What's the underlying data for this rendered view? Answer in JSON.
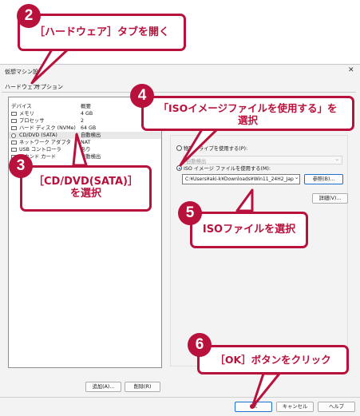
{
  "window": {
    "title": "仮想マシン設定",
    "close_glyph": "✕"
  },
  "tabs": [
    {
      "label": "ハードウェア"
    },
    {
      "label": "オプション"
    }
  ],
  "device_list": {
    "col_device": "デバイス",
    "col_summary": "概要",
    "rows": [
      {
        "device": "メモリ",
        "summary": "4 GB"
      },
      {
        "device": "プロセッサ",
        "summary": "2"
      },
      {
        "device": "ハード ディスク (NVMe)",
        "summary": "64 GB"
      },
      {
        "device": "CD/DVD (SATA)",
        "summary": "自動検出"
      },
      {
        "device": "ネットワーク アダプタ",
        "summary": "NAT"
      },
      {
        "device": "USB コントローラ",
        "summary": "あり"
      },
      {
        "device": "サウンド カード",
        "summary": "自動検出"
      }
    ]
  },
  "device_buttons": {
    "add": "追加(A)...",
    "remove": "削除(R)"
  },
  "connection": {
    "physical_label": "物理ドライブを使用する(P):",
    "physical_dropdown": "自動検出",
    "iso_label": "ISO イメージ ファイルを使用する(M):",
    "iso_path": "C:¥Users¥aki-k¥Downloads¥Win11_24H2_Jap",
    "browse": "参照(B)...",
    "advanced": "詳細(V)..."
  },
  "footer_buttons": {
    "ok": "OK",
    "cancel": "キャンセル",
    "help": "ヘルプ"
  },
  "annotations": [
    {
      "num": "2",
      "text": "［ハードウェア］タブを開く"
    },
    {
      "num": "3",
      "line1": "［CD/DVD(SATA)］",
      "line2": "を選択"
    },
    {
      "num": "4",
      "line1": "「ISOイメージファイルを使用する」を",
      "line2": "選択"
    },
    {
      "num": "5",
      "text": "ISOファイルを選択"
    },
    {
      "num": "6",
      "text": "［OK］ボタンをクリック"
    }
  ],
  "colors": {
    "accent": "#b8123c",
    "select_blue": "#1a6fd0"
  }
}
